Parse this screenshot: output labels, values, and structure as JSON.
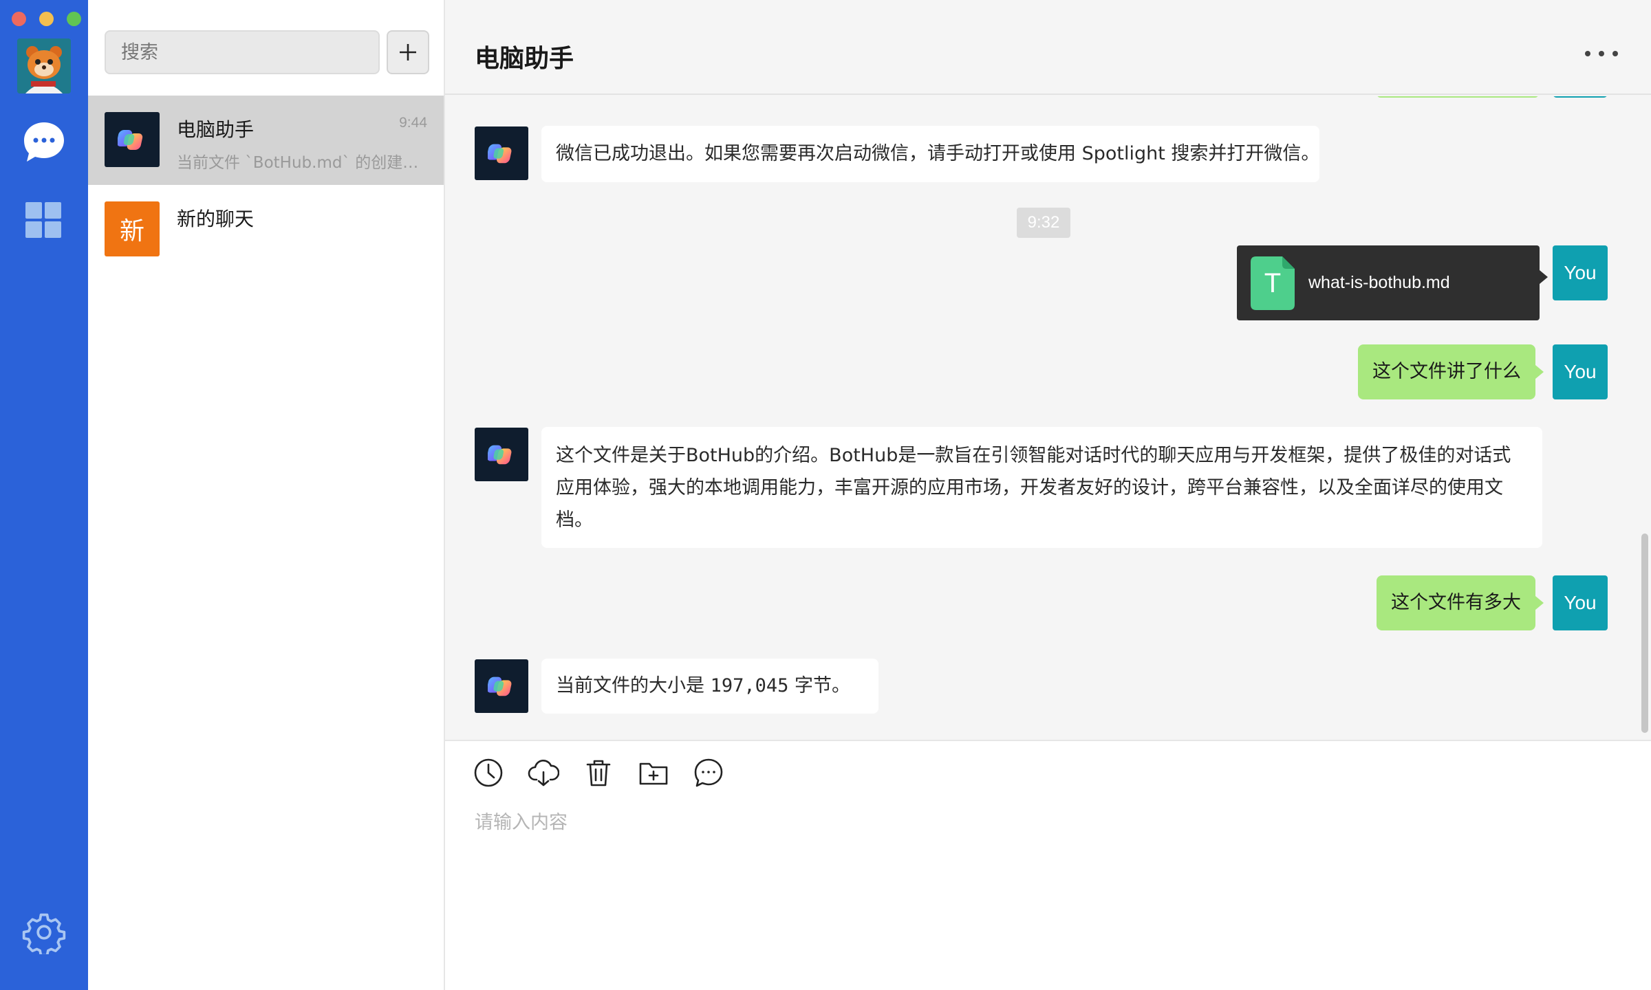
{
  "search": {
    "placeholder": "搜索"
  },
  "conversations": [
    {
      "title": "电脑助手",
      "time": "9:44",
      "preview": "当前文件 `BotHub.md` 的创建…"
    },
    {
      "title": "新的聊天",
      "avatar_text": "新"
    }
  ],
  "chat": {
    "title": "电脑助手",
    "messages": [
      {
        "text": "微信已成功退出。如果您需要再次启动微信，请手动打开或使用 Spotlight 搜索并打开微信。"
      },
      {
        "time": "9:32"
      },
      {
        "file_name": "what-is-bothub.md",
        "file_letter": "T",
        "sender": "You"
      },
      {
        "text": "这个文件讲了什么",
        "sender": "You"
      },
      {
        "text": "这个文件是关于BotHub的介绍。BotHub是一款旨在引领智能对话时代的聊天应用与开发框架，提供了极佳的对话式应用体验，强大的本地调用能力，丰富开源的应用市场，开发者友好的设计，跨平台兼容性，以及全面详尽的使用文档。"
      },
      {
        "text": "这个文件有多大",
        "sender": "You"
      },
      {
        "text_prefix": "当前文件的大小是 ",
        "size": "197,045",
        "text_suffix": " 字节。"
      }
    ]
  },
  "composer": {
    "placeholder": "请输入内容"
  },
  "colors": {
    "rail": "#2b62d9",
    "user_bubble": "#a9e87f",
    "you_avatar": "#0fa0b0",
    "file_card": "#2f2f2f",
    "new_chat_avatar": "#f07412"
  }
}
